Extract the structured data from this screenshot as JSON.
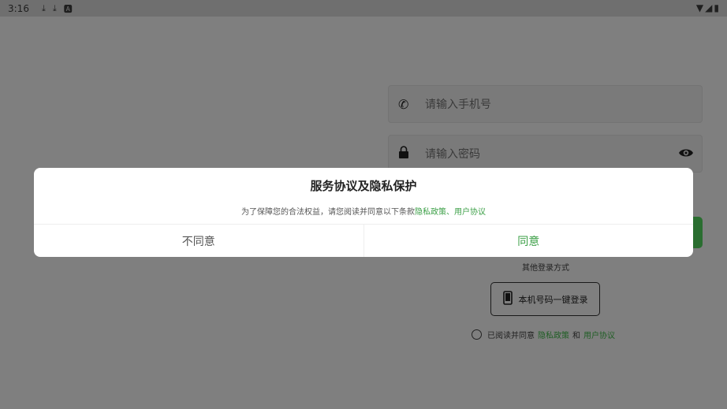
{
  "status_bar": {
    "time": "3:16",
    "icons": [
      "download-icon",
      "download-icon",
      "a-icon"
    ],
    "right_icons": [
      "wifi-icon",
      "signal-icon",
      "battery-icon"
    ]
  },
  "login": {
    "phone_placeholder": "请输入手机号",
    "password_placeholder": "请输入密码",
    "other_methods": "其他登录方式",
    "onekey_label": "本机号码一键登录",
    "agree_prefix": "已阅读并同意",
    "privacy_link": "隐私政策",
    "and": "和",
    "user_agreement_link": "用户协议"
  },
  "dialog": {
    "title": "服务协议及隐私保护",
    "message_prefix": "为了保障您的合法权益，请您阅读并同意以下条款",
    "privacy_link": "隐私政策",
    "separator": "、",
    "user_agreement_link": "用户协议",
    "disagree_label": "不同意",
    "agree_label": "同意"
  },
  "colors": {
    "accent": "#3da048",
    "overlay": "#7f7f7f"
  }
}
